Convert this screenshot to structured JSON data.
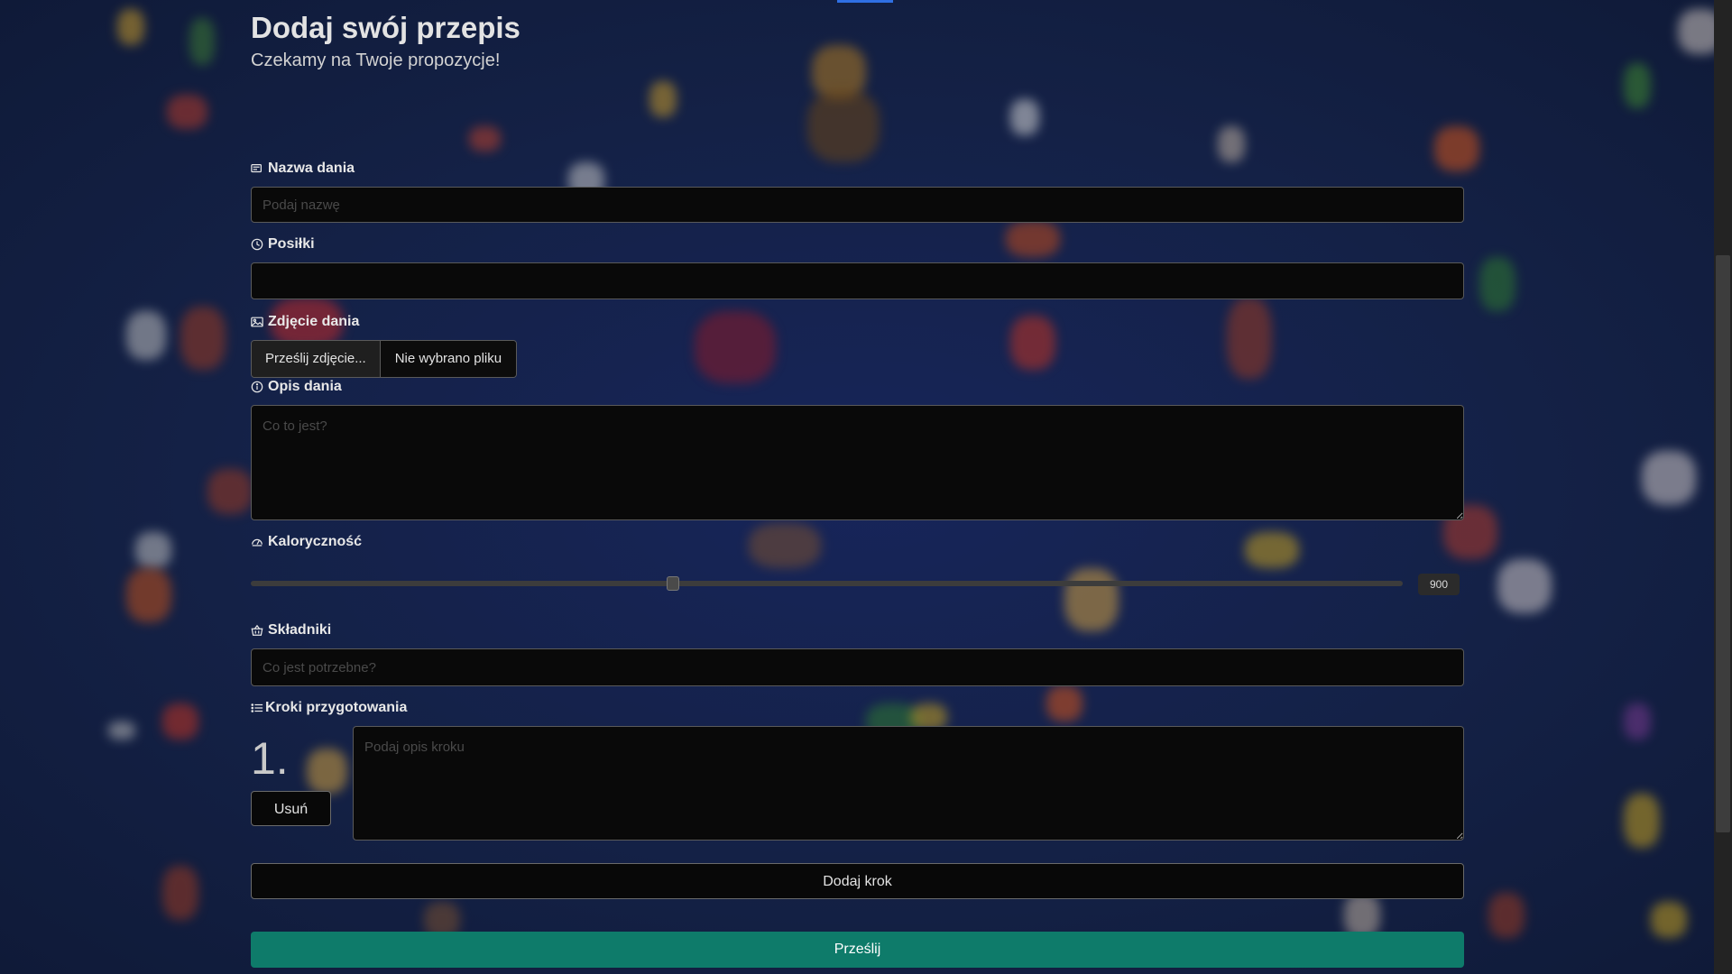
{
  "header": {
    "title": "Dodaj swój przepis",
    "subtitle": "Czekamy na Twoje propozycje!"
  },
  "form": {
    "name": {
      "label": "Nazwa dania",
      "placeholder": "Podaj nazwę",
      "icon": "card-text-icon"
    },
    "meals": {
      "label": "Posiłki",
      "value": "",
      "icon": "clock-icon"
    },
    "photo": {
      "label": "Zdjęcie dania",
      "button": "Prześlij zdjęcie...",
      "file_name": "Nie wybrano pliku",
      "icon": "image-icon"
    },
    "description": {
      "label": "Opis dania",
      "placeholder": "Co to jest?",
      "icon": "info-icon"
    },
    "calories": {
      "label": "Kaloryczność",
      "value": "900",
      "slider_fraction": 0.365,
      "icon": "speedometer-icon"
    },
    "ingredients": {
      "label": "Składniki",
      "placeholder": "Co jest potrzebne?",
      "icon": "basket-icon"
    },
    "steps": {
      "label": "Kroki przygotowania",
      "icon": "list-icon",
      "items": [
        {
          "number": "1.",
          "placeholder": "Podaj opis kroku",
          "remove_label": "Usuń"
        }
      ],
      "add_label": "Dodaj krok"
    },
    "submit_label": "Prześlij"
  },
  "colors": {
    "background": "#142146",
    "submit": "#0e7b6a",
    "field": "#090909"
  }
}
